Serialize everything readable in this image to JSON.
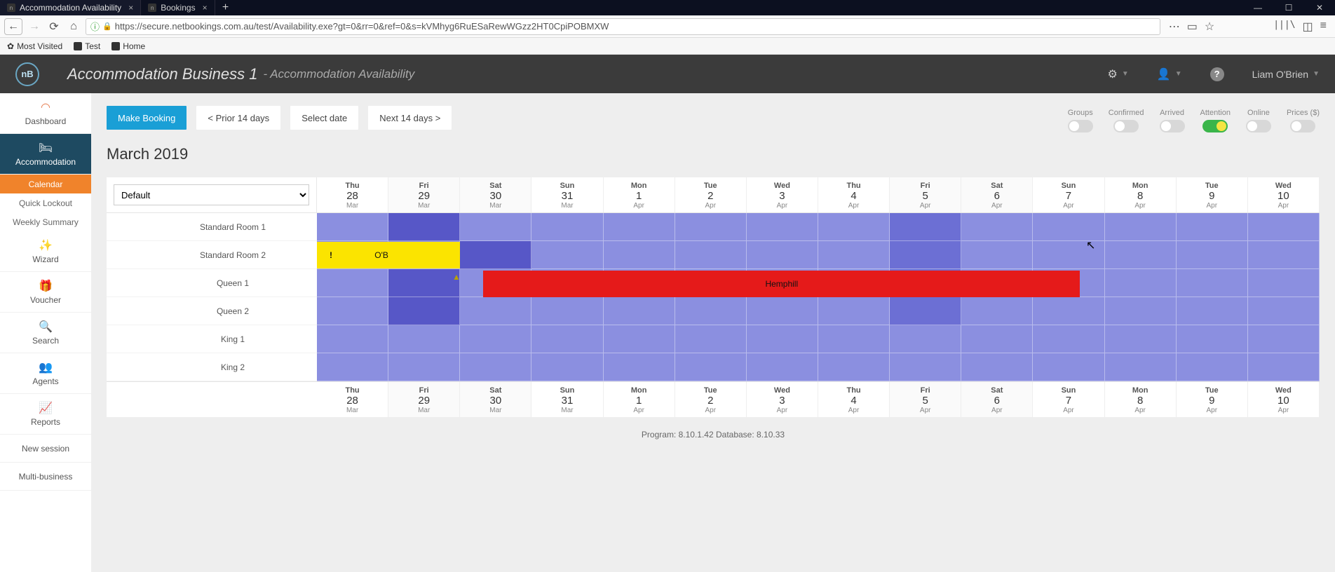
{
  "browser": {
    "tabs": [
      {
        "title": "Accommodation Availability",
        "active": true
      },
      {
        "title": "Bookings",
        "active": false
      }
    ],
    "url": "https://secure.netbookings.com.au/test/Availability.exe?gt=0&rr=0&ref=0&s=kVMhyg6RuESaRewWGzz2HT0CpiPOBMXW",
    "bookmarks": [
      "Most Visited",
      "Test",
      "Home"
    ]
  },
  "header": {
    "logo": "nB",
    "title": "Accommodation Business 1",
    "subtitle": "- Accommodation Availability",
    "user": "Liam O'Brien"
  },
  "sidebar": {
    "items": [
      {
        "label": "Dashboard",
        "icon": "📈"
      },
      {
        "label": "Accommodation",
        "icon": "🛏",
        "active": true
      },
      {
        "label": "Wizard",
        "icon": "✨"
      },
      {
        "label": "Voucher",
        "icon": "🎁"
      },
      {
        "label": "Search",
        "icon": "🔍"
      },
      {
        "label": "Agents",
        "icon": "👥"
      },
      {
        "label": "Reports",
        "icon": "📊"
      },
      {
        "label": "New session",
        "icon": ""
      },
      {
        "label": "Multi-business",
        "icon": ""
      }
    ],
    "subitems": [
      "Calendar",
      "Quick Lockout",
      "Weekly Summary"
    ],
    "active_sub": "Calendar"
  },
  "actions": {
    "make_booking": "Make Booking",
    "prior": "< Prior 14 days",
    "select_date": "Select date",
    "next": "Next 14 days >"
  },
  "month_title": "March 2019",
  "toggles": [
    {
      "label": "Groups",
      "on": false
    },
    {
      "label": "Confirmed",
      "on": false
    },
    {
      "label": "Arrived",
      "on": false
    },
    {
      "label": "Attention",
      "on": true
    },
    {
      "label": "Online",
      "on": false
    },
    {
      "label": "Prices ($)",
      "on": false
    }
  ],
  "dropdown": "Default",
  "dates": [
    {
      "dow": "Thu",
      "dom": "28",
      "mon": "Mar",
      "shade": 0
    },
    {
      "dow": "Fri",
      "dom": "29",
      "mon": "Mar",
      "shade": 1
    },
    {
      "dow": "Sat",
      "dom": "30",
      "mon": "Mar",
      "shade": 1
    },
    {
      "dow": "Sun",
      "dom": "31",
      "mon": "Mar",
      "shade": 0
    },
    {
      "dow": "Mon",
      "dom": "1",
      "mon": "Apr",
      "shade": 0
    },
    {
      "dow": "Tue",
      "dom": "2",
      "mon": "Apr",
      "shade": 0
    },
    {
      "dow": "Wed",
      "dom": "3",
      "mon": "Apr",
      "shade": 0
    },
    {
      "dow": "Thu",
      "dom": "4",
      "mon": "Apr",
      "shade": 0
    },
    {
      "dow": "Fri",
      "dom": "5",
      "mon": "Apr",
      "shade": 1
    },
    {
      "dow": "Sat",
      "dom": "6",
      "mon": "Apr",
      "shade": 1
    },
    {
      "dow": "Sun",
      "dom": "7",
      "mon": "Apr",
      "shade": 0
    },
    {
      "dow": "Mon",
      "dom": "8",
      "mon": "Apr",
      "shade": 0
    },
    {
      "dow": "Tue",
      "dom": "9",
      "mon": "Apr",
      "shade": 0
    },
    {
      "dow": "Wed",
      "dom": "10",
      "mon": "Apr",
      "shade": 0
    }
  ],
  "rooms": [
    "Standard Room 1",
    "Standard Room 2",
    "Queen 1",
    "Queen 2",
    "King 1",
    "King 2"
  ],
  "cell_shades": [
    [
      "",
      "dark",
      "",
      "",
      "",
      "",
      "",
      "",
      "med",
      "",
      "",
      "",
      "",
      ""
    ],
    [
      "",
      "",
      "dark",
      "",
      "",
      "",
      "",
      "",
      "med",
      "",
      "",
      "",
      "",
      ""
    ],
    [
      "",
      "dark",
      "",
      "",
      "",
      "",
      "",
      "",
      "med",
      "",
      "",
      "",
      "",
      ""
    ],
    [
      "",
      "dark",
      "",
      "",
      "",
      "",
      "",
      "",
      "med",
      "",
      "",
      "",
      "",
      ""
    ],
    [
      "",
      "",
      "",
      "",
      "",
      "",
      "",
      "",
      "",
      "",
      "",
      "",
      "",
      ""
    ],
    [
      "",
      "",
      "",
      "",
      "",
      "",
      "",
      "",
      "",
      "",
      "",
      "",
      "",
      ""
    ]
  ],
  "bookings": {
    "obrien": "O'Brien",
    "hemphill": "Hemphill"
  },
  "version": "Program: 8.10.1.42 Database: 8.10.33"
}
